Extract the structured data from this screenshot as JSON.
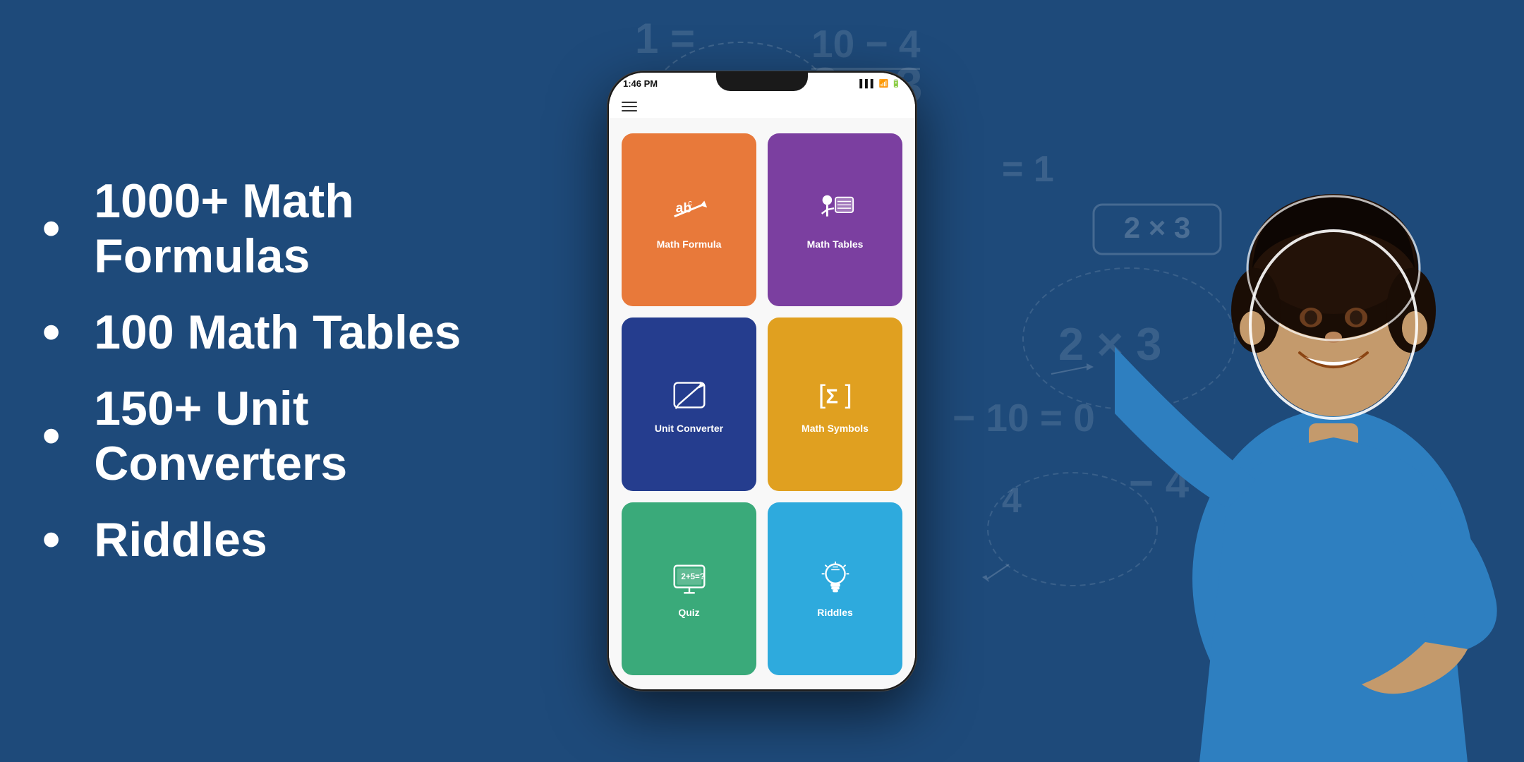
{
  "background": {
    "color": "#1e4a7a"
  },
  "left_section": {
    "features": [
      {
        "id": "formulas",
        "text": "1000+ Math Formulas"
      },
      {
        "id": "tables",
        "text": "100 Math Tables"
      },
      {
        "id": "converters",
        "text": "150+ Unit Converters"
      },
      {
        "id": "riddles",
        "text": "Riddles"
      }
    ]
  },
  "phone": {
    "status_bar": {
      "time": "1:46 PM",
      "battery": "100",
      "signal": "P"
    },
    "app_tiles": [
      {
        "id": "math-formula",
        "label": "Math Formula",
        "color": "#e8793a",
        "icon": "formula"
      },
      {
        "id": "math-tables",
        "label": "Math Tables",
        "color": "#7b3fa0",
        "icon": "tables"
      },
      {
        "id": "unit-converter",
        "label": "Unit Converter",
        "color": "#253d8e",
        "icon": "converter"
      },
      {
        "id": "math-symbols",
        "label": "Math Symbols",
        "color": "#e0a020",
        "icon": "symbols"
      },
      {
        "id": "quiz",
        "label": "Quiz",
        "color": "#3aaa7a",
        "icon": "quiz"
      },
      {
        "id": "riddles",
        "label": "Riddles",
        "color": "#2eaadd",
        "icon": "riddles"
      }
    ]
  },
  "equations": [
    "1 = 1/(2×3)",
    "10 - 4",
    "———",
    "3",
    "2 = 1",
    "2 × 3",
    "- 10 = 0",
    "- 4"
  ]
}
